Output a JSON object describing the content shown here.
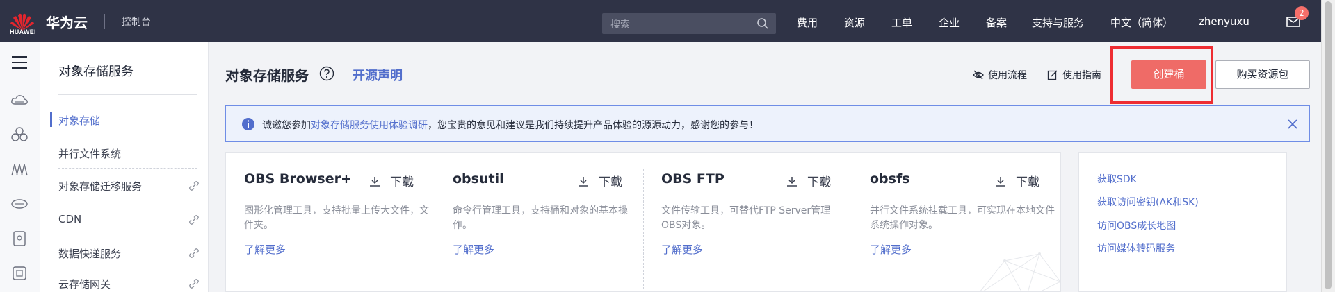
{
  "topbar": {
    "logo_text": "HUAWEI",
    "brand": "华为云",
    "console": "控制台",
    "search_placeholder": "搜索",
    "nav": [
      "费用",
      "资源",
      "工单",
      "企业",
      "备案",
      "支持与服务",
      "中文（简体）",
      "zhenyuxu"
    ],
    "mail_badge": "2"
  },
  "rail": {
    "icons": [
      "menu-icon",
      "cloud-server-icon",
      "cloud-cluster-icon",
      "network-icon",
      "storage-icon",
      "database-icon",
      "container-icon"
    ]
  },
  "sidebar": {
    "title": "对象存储服务",
    "items": [
      {
        "label": "对象存储",
        "active": true,
        "external": false
      },
      {
        "label": "并行文件系统",
        "active": false,
        "external": false
      },
      {
        "label": "对象存储迁移服务",
        "active": false,
        "external": true
      },
      {
        "label": "CDN",
        "active": false,
        "external": true
      },
      {
        "label": "数据快递服务",
        "active": false,
        "external": true
      },
      {
        "label": "云存储网关",
        "active": false,
        "external": true
      }
    ]
  },
  "header": {
    "title": "对象存储服务",
    "oss_link": "开源声明",
    "flow_label": "使用流程",
    "guide_label": "使用指南",
    "create_label": "创建桶",
    "buy_label": "购买资源包"
  },
  "notice": {
    "prefix": "诚邀您参加",
    "link": "对象存储服务使用体验调研",
    "suffix": "，您宝贵的意见和建议是我们持续提升产品体验的源源动力，感谢您的参与！"
  },
  "tools": [
    {
      "name": "OBS Browser+",
      "download": "下载",
      "desc": "图形化管理工具，支持批量上传大文件，文件夹。",
      "more": "了解更多"
    },
    {
      "name": "obsutil",
      "download": "下载",
      "desc": "命令行管理工具，支持桶和对象的基本操作。",
      "more": "了解更多"
    },
    {
      "name": "OBS FTP",
      "download": "下载",
      "desc": "文件传输工具，可替代FTP Server管理OBS对象。",
      "more": "了解更多"
    },
    {
      "name": "obsfs",
      "download": "下载",
      "desc": "并行文件系统挂载工具，可实现在本地文件系统操作对象。",
      "more": "了解更多"
    }
  ],
  "quick_links": [
    "获取SDK",
    "获取访问密钥(AK和SK)",
    "访问OBS成长地图",
    "访问媒体转码服务"
  ],
  "colors": {
    "topbar": "#2f3346",
    "accent": "#526ecc",
    "create": "#ef6b67",
    "highlight": "#ee2d32"
  }
}
